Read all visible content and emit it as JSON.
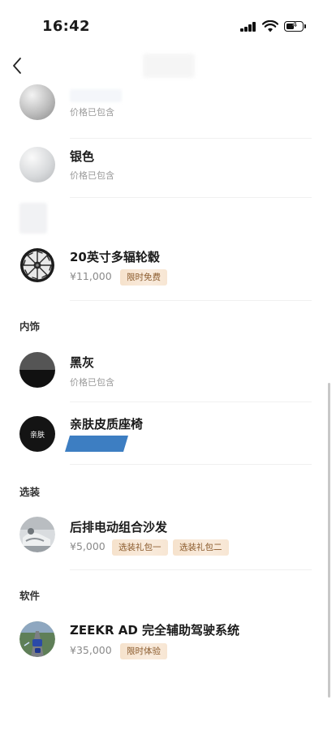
{
  "status_bar": {
    "time": "16:42",
    "battery_text": "4"
  },
  "exterior": {
    "items": [
      {
        "name": "",
        "status": "价格已包含"
      },
      {
        "name": "银色",
        "status": "价格已包含"
      }
    ],
    "wheel": {
      "name": "20英寸多辐轮毂",
      "price": "¥11,000",
      "badge": "限时免费"
    }
  },
  "interior": {
    "title": "内饰",
    "items": [
      {
        "name": "黑灰",
        "status": "价格已包含"
      },
      {
        "name": "亲肤皮质座椅",
        "icon_text": "亲肤"
      }
    ]
  },
  "options": {
    "title": "选装",
    "item": {
      "name": "后排电动组合沙发",
      "price": "¥5,000",
      "badges": [
        "选装礼包一",
        "选装礼包二"
      ]
    }
  },
  "software": {
    "title": "软件",
    "item": {
      "name": "ZEEKR AD 完全辅助驾驶系统",
      "price": "¥35,000",
      "badge": "限时体验"
    }
  },
  "colors": {
    "highlight_blue": "#3d7ec2",
    "badge_text": "#8a5a2c"
  }
}
